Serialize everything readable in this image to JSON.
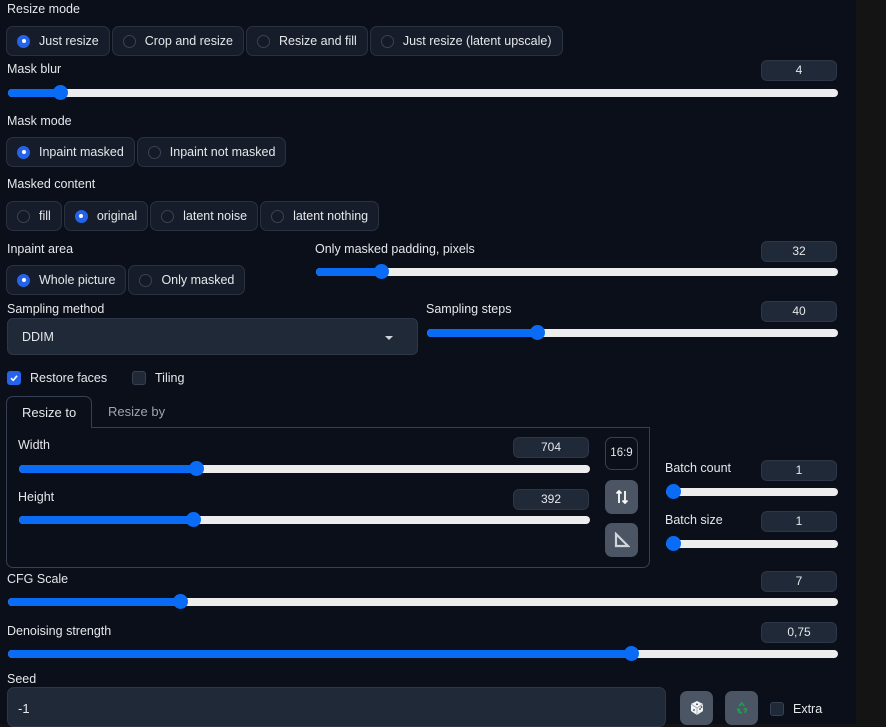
{
  "resize_mode": {
    "label": "Resize mode",
    "options": [
      "Just resize",
      "Crop and resize",
      "Resize and fill",
      "Just resize (latent upscale)"
    ],
    "selected": 0
  },
  "mask_blur": {
    "label": "Mask blur",
    "value": "4",
    "fraction": 0.0625
  },
  "mask_mode": {
    "label": "Mask mode",
    "options": [
      "Inpaint masked",
      "Inpaint not masked"
    ],
    "selected": 0
  },
  "masked_content": {
    "label": "Masked content",
    "options": [
      "fill",
      "original",
      "latent noise",
      "latent nothing"
    ],
    "selected": 1
  },
  "inpaint_area": {
    "label": "Inpaint area",
    "options": [
      "Whole picture",
      "Only masked"
    ],
    "selected": 0
  },
  "only_masked_padding": {
    "label": "Only masked padding, pixels",
    "value": "32",
    "fraction": 0.125
  },
  "sampling_method": {
    "label": "Sampling method",
    "value": "DDIM"
  },
  "sampling_steps": {
    "label": "Sampling steps",
    "value": "40",
    "fraction": 0.268
  },
  "restore_faces": {
    "label": "Restore faces",
    "checked": true
  },
  "tiling": {
    "label": "Tiling",
    "checked": false
  },
  "resize_tabs": [
    {
      "label": "Resize to",
      "active": true
    },
    {
      "label": "Resize by",
      "active": false
    }
  ],
  "width": {
    "label": "Width",
    "value": "704",
    "fraction": 0.31
  },
  "height": {
    "label": "Height",
    "value": "392",
    "fraction": 0.305
  },
  "aspect_ratio_label": "16:9",
  "swap_icon": "swap-dimensions-icon",
  "ruler_icon": "triangle-ruler-icon",
  "batch_count": {
    "label": "Batch count",
    "value": "1",
    "fraction": 0.0
  },
  "batch_size": {
    "label": "Batch size",
    "value": "1",
    "fraction": 0.0
  },
  "cfg_scale": {
    "label": "CFG Scale",
    "value": "7",
    "fraction": 0.207
  },
  "denoising_strength": {
    "label": "Denoising strength",
    "value": "0,75",
    "fraction": 0.75
  },
  "seed": {
    "label": "Seed",
    "value": "-1"
  },
  "random_seed_icon": "dice-icon",
  "reuse_seed_icon": "recycle-icon",
  "extra": {
    "label": "Extra",
    "checked": false
  },
  "colors": {
    "accent": "#0a6cf5",
    "background": "#0b0f19",
    "recycle": "#16a34a"
  }
}
